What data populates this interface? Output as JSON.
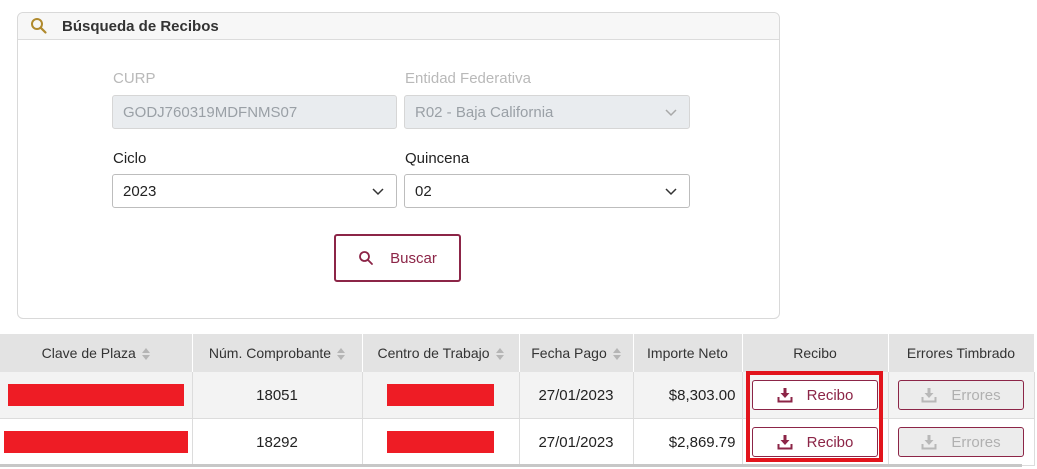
{
  "search": {
    "title": "Búsqueda de Recibos",
    "curp_label": "CURP",
    "curp_value": "GODJ760319MDFNMS07",
    "entidad_label": "Entidad Federativa",
    "entidad_value": "R02 - Baja California",
    "ciclo_label": "Ciclo",
    "ciclo_value": "2023",
    "quincena_label": "Quincena",
    "quincena_value": "02",
    "buscar_label": "Buscar"
  },
  "table": {
    "headers": {
      "clave": "Clave de Plaza",
      "comprobante": "Núm. Comprobante",
      "centro": "Centro de Trabajo",
      "fecha": "Fecha Pago",
      "importe": "Importe Neto",
      "recibo": "Recibo",
      "errores": "Errores Timbrado"
    },
    "rows": [
      {
        "comprobante": "18051",
        "fecha": "27/01/2023",
        "importe": "$8,303.00",
        "recibo": "Recibo",
        "errores": "Errores"
      },
      {
        "comprobante": "18292",
        "fecha": "27/01/2023",
        "importe": "$2,869.79",
        "recibo": "Recibo",
        "errores": "Errores"
      }
    ]
  },
  "colors": {
    "accent": "#8c2547",
    "redaction": "#ee1c25",
    "highlight": "#e2141c",
    "search_icon": "#b08a2e"
  }
}
